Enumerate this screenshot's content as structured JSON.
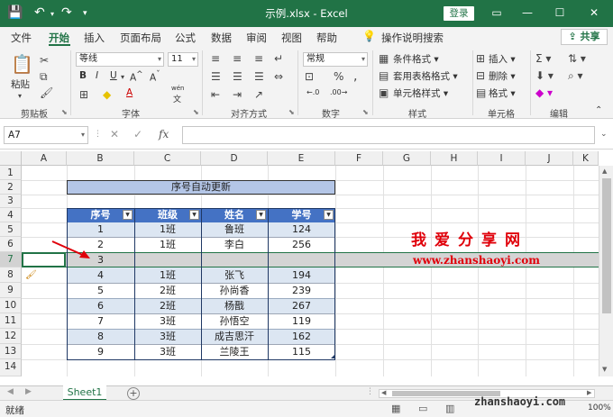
{
  "titlebar": {
    "title": "示例.xlsx - Excel",
    "login_label": "登录",
    "bg": "#217346"
  },
  "tabs": [
    "文件",
    "开始",
    "插入",
    "页面布局",
    "公式",
    "数据",
    "审阅",
    "视图",
    "帮助"
  ],
  "tell_me": "操作说明搜索",
  "share_label": "共享",
  "ribbon": {
    "paste_label": "粘贴",
    "font_name": "等线",
    "font_size": "11",
    "number_format": "常规",
    "cond_format": "条件格式",
    "table_format": "套用表格格式",
    "cell_style": "单元格样式",
    "insert": "插入",
    "delete": "删除",
    "format": "格式",
    "groups": {
      "clipboard": "剪贴板",
      "font": "字体",
      "alignment": "对齐方式",
      "number": "数字",
      "styles": "样式",
      "cells": "单元格",
      "editing": "编辑"
    }
  },
  "namebox": "A7",
  "formula_value": "",
  "columns": [
    "A",
    "B",
    "C",
    "D",
    "E",
    "F",
    "G",
    "H",
    "I",
    "J",
    "K"
  ],
  "rows": [
    "1",
    "2",
    "3",
    "4",
    "5",
    "6",
    "7",
    "8",
    "9",
    "10",
    "11",
    "12",
    "13",
    "14"
  ],
  "sheet": {
    "title": "序号自动更新",
    "headers": [
      "序号",
      "班级",
      "姓名",
      "学号"
    ],
    "data": [
      [
        "1",
        "1班",
        "鲁班",
        "124"
      ],
      [
        "2",
        "1班",
        "李白",
        "256"
      ],
      [
        "3",
        "",
        "",
        ""
      ],
      [
        "4",
        "1班",
        "张飞",
        "194"
      ],
      [
        "5",
        "2班",
        "孙尚香",
        "239"
      ],
      [
        "6",
        "2班",
        "杨戬",
        "267"
      ],
      [
        "7",
        "3班",
        "孙悟空",
        "119"
      ],
      [
        "8",
        "3班",
        "成吉思汗",
        "162"
      ],
      [
        "9",
        "3班",
        "兰陵王",
        "115"
      ]
    ]
  },
  "watermark": {
    "cn": "我爱分享网",
    "url": "www.zhanshaoyi.com",
    "color": "#e0000a"
  },
  "sheet_tab": "Sheet1",
  "status": {
    "ready": "就绪",
    "url": "zhanshaoyi.com",
    "zoom": "100%"
  }
}
